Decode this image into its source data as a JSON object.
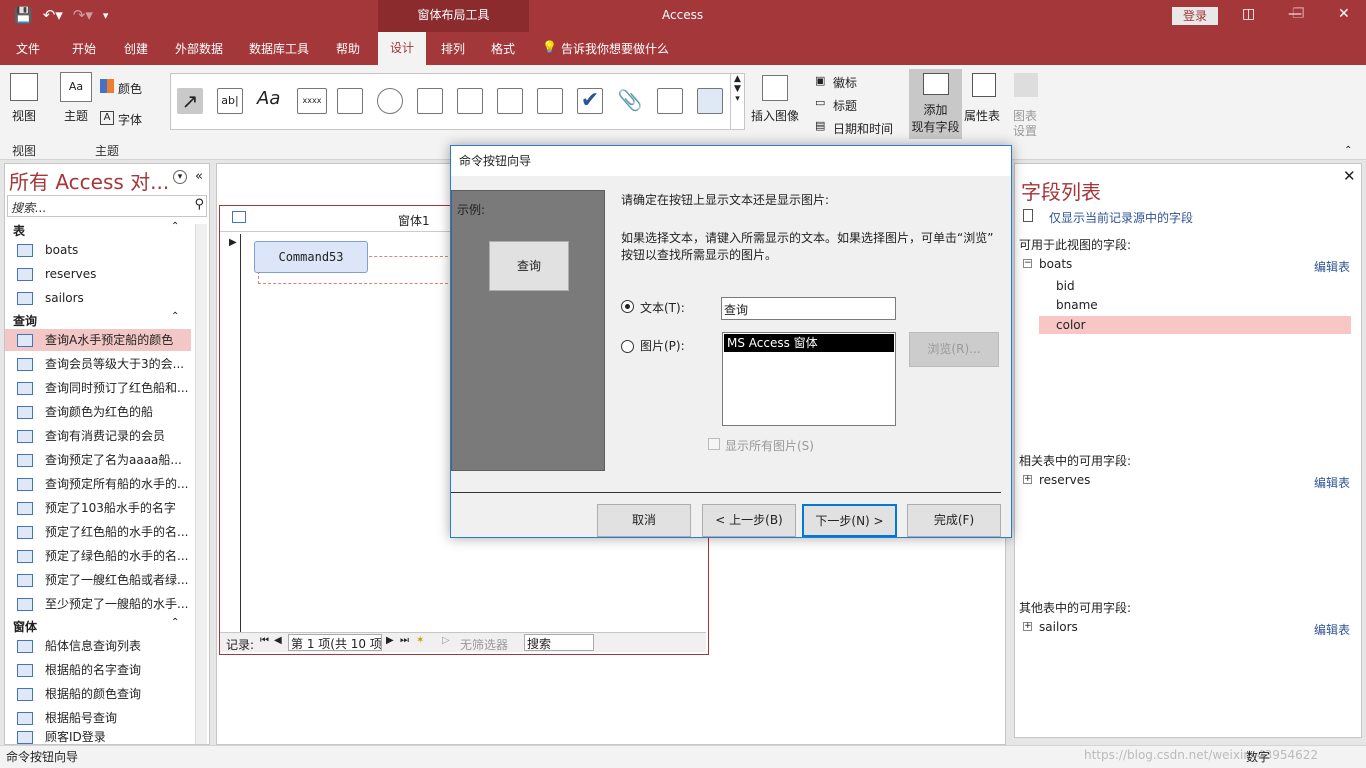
{
  "titlebar": {
    "context_tab": "窗体布局工具",
    "app": "Access",
    "signin": "登录"
  },
  "tabs": [
    "文件",
    "开始",
    "创建",
    "外部数据",
    "数据库工具",
    "帮助",
    "设计",
    "排列",
    "格式"
  ],
  "tell_me": "告诉我你想要做什么",
  "ribbon": {
    "view": "视图",
    "view_group": "视图",
    "theme": "主题",
    "colors": "颜色",
    "fonts": "字体",
    "theme_group": "主题",
    "insert_image": "插入图像",
    "logo": "徽标",
    "title": "标题",
    "datetime": "日期和时间",
    "add_fields": "添加\n现有字段",
    "add_fields_l1": "添加",
    "add_fields_l2": "现有字段",
    "property_sheet": "属性表",
    "chart_settings_l1": "图表",
    "chart_settings_l2": "设置",
    "ctrl_label": "ab|",
    "ctrl_aa": "Aa",
    "ctrl_xxxx": "xxxx"
  },
  "nav": {
    "title": "所有 Access 对...",
    "search_placeholder": "搜索...",
    "sections": [
      {
        "label": "表",
        "items": [
          "boats",
          "reserves",
          "sailors"
        ]
      },
      {
        "label": "查询",
        "items": [
          "查询A水手预定船的颜色",
          "查询会员等级大于3的会...",
          "查询同时预订了红色船和...",
          "查询颜色为红色的船",
          "查询有消费记录的会员",
          "查询预定了名为aaaa船...",
          "查询预定所有船的水手的...",
          "预定了103船水手的名字",
          "预定了红色船的水手的名...",
          "预定了绿色船的水手的名...",
          "预定了一艘红色船或者绿...",
          "至少预定了一艘船的水手..."
        ]
      },
      {
        "label": "窗体",
        "items": [
          "船体信息查询列表",
          "根据船的名字查询",
          "根据船的颜色查询",
          "根据船号查询",
          "顾客ID登录"
        ]
      }
    ]
  },
  "form": {
    "tab_title": "窗体1",
    "command": "Command53",
    "recnav": {
      "label": "记录:",
      "position": "第 1 项(共 10 项",
      "filter": "无筛选器",
      "search": "搜索"
    }
  },
  "fieldlist": {
    "title": "字段列表",
    "show_only": "仅显示当前记录源中的字段",
    "avail_label": "可用于此视图的字段:",
    "table": "boats",
    "edit_table": "编辑表",
    "fields": [
      "bid",
      "bname",
      "color"
    ],
    "related_label": "相关表中的可用字段:",
    "related_table": "reserves",
    "other_label": "其他表中的可用字段:",
    "other_table": "sailors"
  },
  "dialog": {
    "title": "命令按钮向导",
    "example_label": "示例:",
    "preview_text": "查询",
    "prompt": "请确定在按钮上显示文本还是显示图片:",
    "desc1": "如果选择文本，请键入所需显示的文本。如果选择图片，可单击“浏览”",
    "desc2": "按钮以查找所需显示的图片。",
    "text_option": "文本(T):",
    "text_value": "查询",
    "picture_option": "图片(P):",
    "picture_item": "MS Access 窗体",
    "browse": "浏览(R)...",
    "show_all": "显示所有图片(S)",
    "cancel": "取消",
    "back": "< 上一步(B)",
    "next": "下一步(N) >",
    "finish": "完成(F)"
  },
  "statusbar": {
    "left": "命令按钮向导",
    "right": "数字"
  },
  "watermark": "https://blog.csdn.net/weixin_43954622"
}
